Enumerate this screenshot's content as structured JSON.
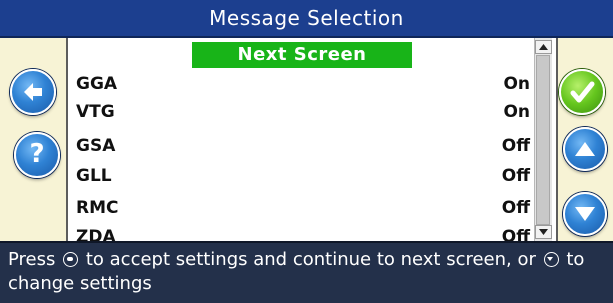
{
  "title": "Message Selection",
  "next_screen_label": "Next Screen",
  "messages": [
    {
      "name": "GGA",
      "state": "On"
    },
    {
      "name": "VTG",
      "state": "On"
    },
    {
      "name": "GSA",
      "state": "Off"
    },
    {
      "name": "GLL",
      "state": "Off"
    },
    {
      "name": "RMC",
      "state": "Off"
    },
    {
      "name": "ZDA",
      "state": "Off"
    }
  ],
  "status": {
    "part1": "Press",
    "part2": "to accept settings and continue to next screen, or",
    "part3": "to change settings",
    "icon1": "ok-button-icon",
    "icon2": "down-arrow-button-icon"
  },
  "buttons": {
    "back": "back-arrow-icon",
    "help": "?",
    "accept": "checkmark-icon",
    "up": "up-arrow-icon",
    "down": "down-arrow-icon"
  },
  "colors": {
    "title_bar": "#1c3f8f",
    "status_bar": "#23304a",
    "next_screen": "#18b418",
    "panel_bg": "#f7f3d5",
    "list_bg": "#ffffff"
  }
}
